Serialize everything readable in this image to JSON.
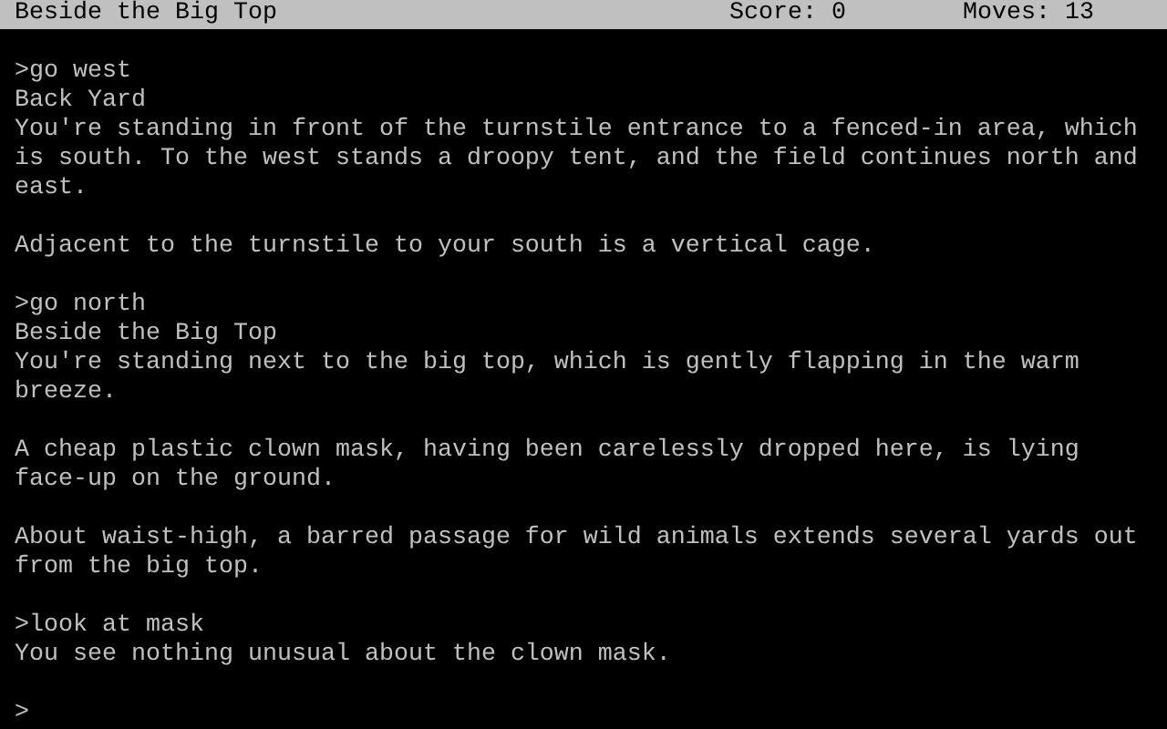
{
  "status_bar": {
    "location": "Beside the Big Top",
    "score": "Score: 0",
    "moves": "Moves: 13"
  },
  "transcript": [
    {
      "kind": "command",
      "text": ">go west"
    },
    {
      "kind": "room_name",
      "text": "Back Yard"
    },
    {
      "kind": "text",
      "text": "You're standing in front of the turnstile entrance to a fenced-in area, which is south. To the west stands a droopy tent, and the field continues north and east."
    },
    {
      "kind": "text",
      "text": "Adjacent to the turnstile to your south is a vertical cage."
    },
    {
      "kind": "command",
      "text": ">go north"
    },
    {
      "kind": "room_name",
      "text": "Beside the Big Top"
    },
    {
      "kind": "text",
      "text": "You're standing next to the big top, which is gently flapping in the warm breeze."
    },
    {
      "kind": "text",
      "text": "A cheap plastic clown mask, having been carelessly dropped here, is lying face-up on the ground."
    },
    {
      "kind": "text",
      "text": "About waist-high, a barred passage for wild animals extends several yards out from the big top."
    },
    {
      "kind": "command",
      "text": ">look at mask"
    },
    {
      "kind": "text",
      "text": "You see nothing unusual about the clown mask."
    }
  ],
  "prompt": ">"
}
